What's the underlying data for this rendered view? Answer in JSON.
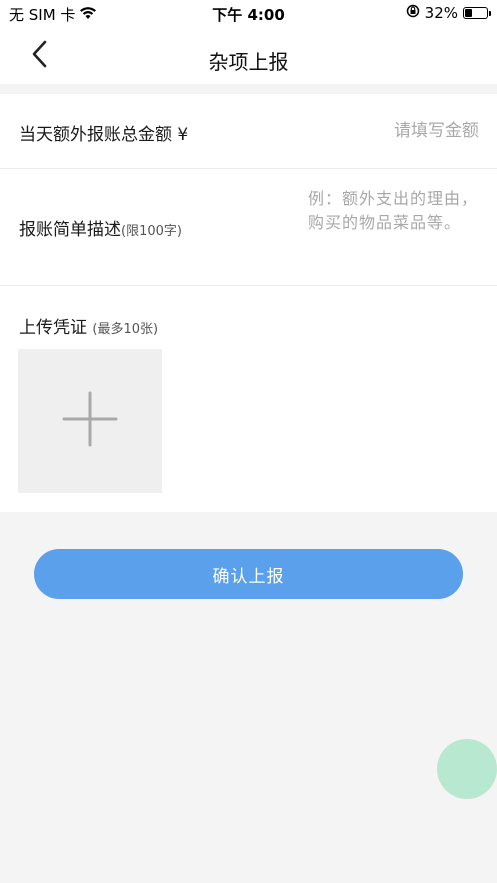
{
  "status_bar": {
    "carrier": "无 SIM 卡",
    "time": "下午 4:00",
    "battery_percent_text": "32%",
    "battery_level": 0.32,
    "icons": [
      "wifi-icon",
      "orientation-lock-icon",
      "battery-icon"
    ]
  },
  "nav": {
    "title": "杂项上报",
    "back_icon": "chevron-left-icon"
  },
  "form": {
    "amount": {
      "label": "当天额外报账总金额 ¥",
      "value": "",
      "placeholder": "请填写金额"
    },
    "description": {
      "label": "报账简单描述",
      "limit_hint": "(限100字)",
      "value": "",
      "placeholder": "例：额外支出的理由，购买的物品菜品等。"
    },
    "upload": {
      "label": "上传凭证",
      "limit_hint": "(最多10张)",
      "add_icon": "plus-icon"
    }
  },
  "submit": {
    "label": "确认上报"
  },
  "colors": {
    "primary": "#5aa0ea",
    "float_button": "#b8e8cf",
    "page_bg": "#f4f4f4",
    "placeholder": "#a8a8a8"
  }
}
